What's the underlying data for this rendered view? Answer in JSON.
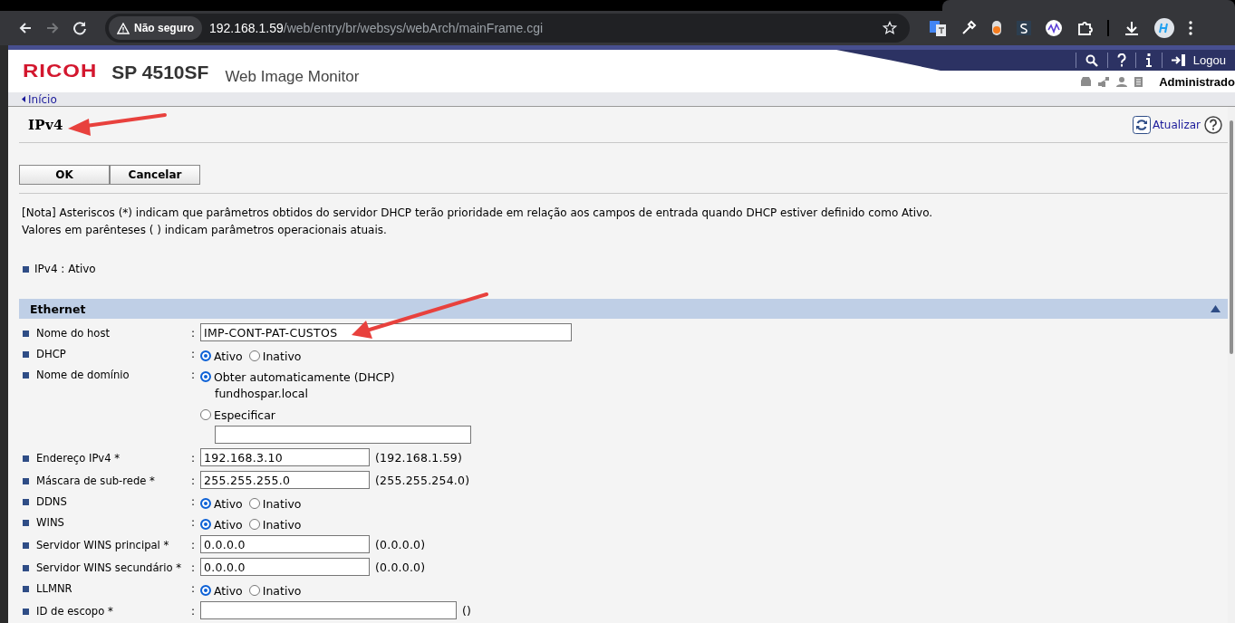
{
  "browser": {
    "security_label": "Não seguro",
    "url_host": "192.168.1.59",
    "url_path": "/web/entry/br/websys/webArch/mainFrame.cgi"
  },
  "header": {
    "brand": "RICOH",
    "model": "SP 4510SF",
    "product": "Web Image Monitor",
    "logout": "Logou",
    "user": "Administrado"
  },
  "breadcrumb": "Início",
  "page": {
    "title": "IPv4",
    "refresh": "Atualizar"
  },
  "buttons": [
    "OK",
    "Cancelar"
  ],
  "notes": [
    "[Nota] Asteriscos (*) indicam que parâmetros obtidos do servidor DHCP terão prioridade em relação aos campos de entrada quando DHCP estiver definido como Ativo.",
    "Valores em parênteses ( ) indicam parâmetros operacionais atuais."
  ],
  "status": {
    "label": "IPv4",
    "separator": ":",
    "value": "Ativo"
  },
  "section": {
    "title": "Ethernet",
    "expanded": true,
    "rows": [
      {
        "kind": "text",
        "label": "Nome do host",
        "separator": ":",
        "value": "IMP-CONT-PAT-CUSTOS"
      },
      {
        "kind": "radio",
        "label": "DHCP",
        "separator": ":",
        "options": [
          {
            "label": "Ativo",
            "selected": true
          },
          {
            "label": "Inativo",
            "selected": false
          }
        ]
      },
      {
        "kind": "choice",
        "label": "Nome de domínio",
        "separator": ":",
        "options": [
          {
            "label": "Obter automaticamente (DHCP)",
            "selected": true,
            "detail": "fundhospar.local"
          },
          {
            "label": "Especificar",
            "selected": false,
            "input": true
          }
        ]
      },
      {
        "kind": "text",
        "label": "Endereço IPv4 *",
        "separator": ":",
        "value": "192.168.3.10",
        "current": "(192.168.1.59)"
      },
      {
        "kind": "text",
        "label": "Máscara de sub-rede *",
        "separator": ":",
        "value": "255.255.255.0",
        "current": "(255.255.254.0)"
      },
      {
        "kind": "radio",
        "label": "DDNS",
        "separator": ":",
        "options": [
          {
            "label": "Ativo",
            "selected": true
          },
          {
            "label": "Inativo",
            "selected": false
          }
        ]
      },
      {
        "kind": "radio",
        "label": "WINS",
        "separator": ":",
        "options": [
          {
            "label": "Ativo",
            "selected": true
          },
          {
            "label": "Inativo",
            "selected": false
          }
        ]
      },
      {
        "kind": "text",
        "label": "Servidor WINS principal *",
        "separator": ":",
        "value": "0.0.0.0",
        "current": "(0.0.0.0)"
      },
      {
        "kind": "text",
        "label": "Servidor WINS secundário *",
        "separator": ":",
        "value": "0.0.0.0",
        "current": "(0.0.0.0)"
      },
      {
        "kind": "radio",
        "label": "LLMNR",
        "separator": ":",
        "options": [
          {
            "label": "Ativo",
            "selected": true
          },
          {
            "label": "Inativo",
            "selected": false
          }
        ]
      },
      {
        "kind": "text",
        "label": "ID de escopo *",
        "separator": ":",
        "current": "()"
      }
    ]
  }
}
